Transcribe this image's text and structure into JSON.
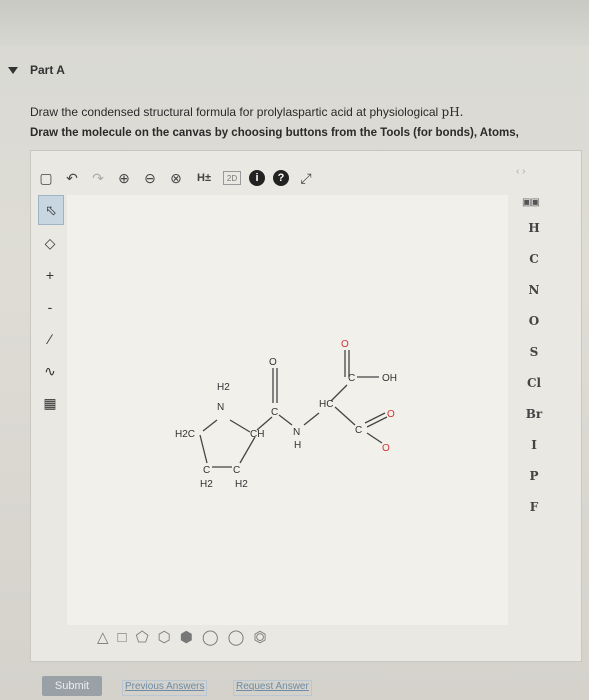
{
  "header": {
    "part_title": "Part A",
    "instruction": "Draw the condensed structural formula for prolylaspartic acid at physiological ",
    "instruction_ph": "pH.",
    "tool_instruction": "Draw the molecule on the canvas by choosing buttons from the Tools (for bonds), Atoms,"
  },
  "toolbar": {
    "h_toggle": "H±",
    "label_2d": "2D",
    "info": "i",
    "help": "?"
  },
  "atoms": [
    "H",
    "C",
    "N",
    "O",
    "S",
    "Cl",
    "Br",
    "I",
    "P",
    "F"
  ],
  "molecule": {
    "h2_top": "H2",
    "n_plus": "N",
    "h2c": "H2C",
    "ch_ring": "CH",
    "c_bottom_left": "C",
    "c_bottom_right": "C",
    "h2_bl": "H2",
    "h2_br": "H2",
    "o_amide": "O",
    "c_amide": "C",
    "n_amide": "N",
    "h_amide": "H",
    "hc_alpha": "HC",
    "o_top": "O",
    "c_top": "C",
    "oh": "OH",
    "c_carboxylate": "C",
    "o_carboxylate": "O",
    "o_minus": "O"
  },
  "actions": {
    "submit": "Submit",
    "previous_answers": "Previous Answers",
    "request_answer": "Request Answer"
  }
}
